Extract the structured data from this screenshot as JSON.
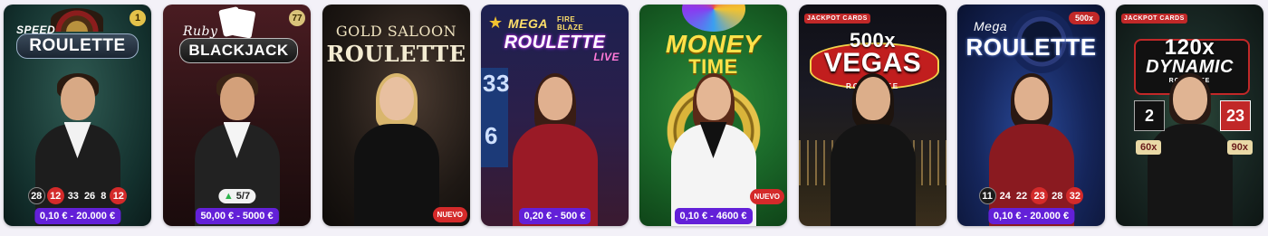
{
  "tiles": [
    {
      "title_top": "SPEED",
      "title_main": "ROULETTE",
      "corner_badge": "1",
      "numbers": [
        {
          "v": "28",
          "c": "black"
        },
        {
          "v": "12",
          "c": "red"
        },
        {
          "v": "33",
          "c": "plain"
        },
        {
          "v": "26",
          "c": "plain"
        },
        {
          "v": "8",
          "c": "plain"
        },
        {
          "v": "12",
          "c": "red"
        }
      ],
      "price": "0,10 € - 20.000 €"
    },
    {
      "title_top": "Ruby",
      "title_main": "BLACKJACK",
      "corner_badge": "77",
      "seats": "5/7",
      "price": "50,00 € - 5000 €"
    },
    {
      "title_top": "GOLD SALOON",
      "title_main": "ROULETTE",
      "badge": "NUEVO"
    },
    {
      "title_top": "MEGA",
      "title_top2": "FIRE BLAZE",
      "title_main": "ROULETTE",
      "title_sub": "LIVE",
      "wall_numbers": [
        "33",
        "6"
      ],
      "price": "0,20 € - 500 €"
    },
    {
      "title_top": "MONEY",
      "title_main": "TIME",
      "badge": "NUEVO",
      "price": "0,10 € - 4600 €"
    },
    {
      "title_top": "JACKPOT CARDS",
      "title_main1": "500x",
      "title_main": "VEGAS",
      "title_sub": "ROULETTE"
    },
    {
      "title_top": "Mega",
      "title_main": "ROULETTE",
      "corner_badge": "500x",
      "numbers": [
        {
          "v": "11",
          "c": "black"
        },
        {
          "v": "24",
          "c": "plain"
        },
        {
          "v": "22",
          "c": "plain"
        },
        {
          "v": "23",
          "c": "red"
        },
        {
          "v": "28",
          "c": "plain"
        },
        {
          "v": "32",
          "c": "red"
        }
      ],
      "price": "0,10 € - 20.000 €"
    },
    {
      "title_top": "JACKPOT CARDS",
      "title_main1": "120x",
      "title_main": "DYNAMIC",
      "title_sub": "ROULETTE",
      "scores": [
        "2",
        "23"
      ],
      "multipliers": [
        "60x",
        "90x"
      ]
    }
  ]
}
